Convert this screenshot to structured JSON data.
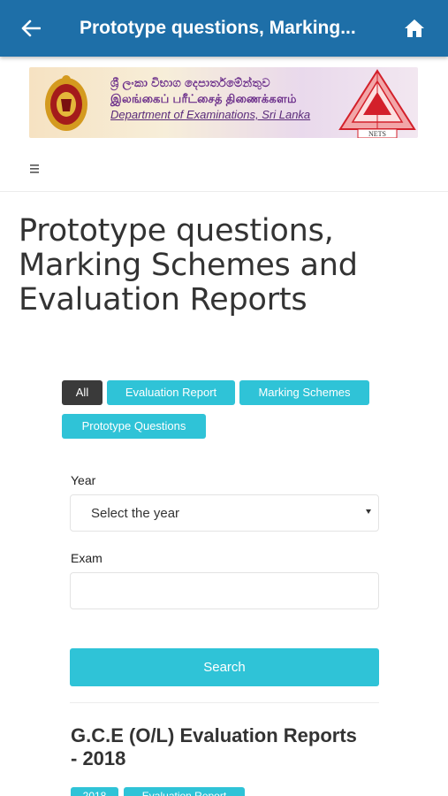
{
  "appbar": {
    "title": "Prototype questions, Marking...",
    "back_icon": "arrow-left-icon",
    "home_icon": "home-icon",
    "color": "#1e6fa8"
  },
  "banner": {
    "line_sinhala": "ශ්‍රී ලංකා විභාග දෙපාර්තමේන්තුව",
    "line_tamil": "இலங்கைப் பரீட்சைத் திணைக்களம்",
    "line_english": "Department of Examinations, Sri Lanka",
    "nets_label": "NETS"
  },
  "menu_icon": "hamburger-menu-icon",
  "page_title": "Prototype questions, Marking Schemes and Evaluation Reports",
  "filters": [
    {
      "label": "All",
      "active": true
    },
    {
      "label": "Evaluation Report",
      "active": false
    },
    {
      "label": "Marking Schemes",
      "active": false
    },
    {
      "label": "Prototype Questions",
      "active": false
    }
  ],
  "form": {
    "year_label": "Year",
    "year_value": "Select the year",
    "exam_label": "Exam",
    "exam_value": "",
    "search_label": "Search"
  },
  "result": {
    "title": "G.C.E (O/L) Evaluation Reports - 2018",
    "tags": [
      "2018",
      "Evaluation Report"
    ]
  },
  "colors": {
    "accent": "#2fc3d7",
    "active_chip": "#3a3a3a"
  }
}
